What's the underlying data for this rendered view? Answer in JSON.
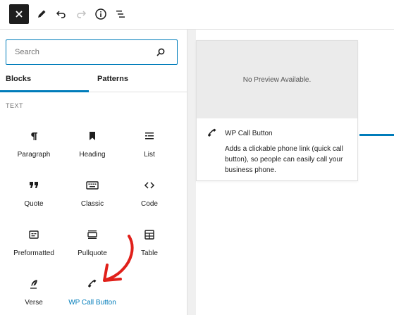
{
  "toolbar": {
    "buttons": [
      {
        "name": "close-icon"
      },
      {
        "name": "pencil-icon"
      },
      {
        "name": "undo-icon"
      },
      {
        "name": "redo-icon"
      },
      {
        "name": "info-icon"
      },
      {
        "name": "list-view-icon"
      }
    ]
  },
  "search": {
    "placeholder": "Search"
  },
  "tabs": {
    "blocks": "Blocks",
    "patterns": "Patterns"
  },
  "section_title": "TEXT",
  "blocks": [
    {
      "label": "Paragraph",
      "icon": "paragraph-icon"
    },
    {
      "label": "Heading",
      "icon": "bookmark-icon"
    },
    {
      "label": "List",
      "icon": "list-icon"
    },
    {
      "label": "Quote",
      "icon": "quote-icon"
    },
    {
      "label": "Classic",
      "icon": "keyboard-icon"
    },
    {
      "label": "Code",
      "icon": "code-icon"
    },
    {
      "label": "Preformatted",
      "icon": "preformatted-icon"
    },
    {
      "label": "Pullquote",
      "icon": "pullquote-icon"
    },
    {
      "label": "Table",
      "icon": "table-icon"
    },
    {
      "label": "Verse",
      "icon": "feather-icon"
    },
    {
      "label": "WP Call Button",
      "icon": "phone-icon"
    }
  ],
  "preview": {
    "no_preview": "No Preview Available.",
    "title": "WP Call Button",
    "description": "Adds a clickable phone link (quick call button), so people can easily call your business phone."
  },
  "colors": {
    "accent": "#007cba",
    "arrow": "#e0201a",
    "dark": "#1e1e1e"
  }
}
